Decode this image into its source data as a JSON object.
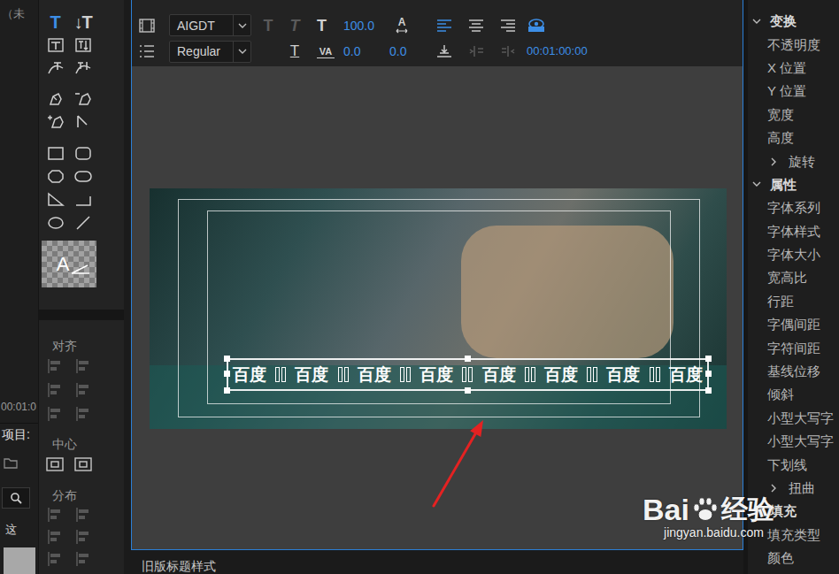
{
  "left_strip": {
    "title": "（未",
    "timecode": "00:01:0",
    "tab": "项目:",
    "item": "这"
  },
  "tools": [
    {
      "kind": "type",
      "glyph": "T",
      "selected": true
    },
    {
      "kind": "vertical-type",
      "glyph": "↓T",
      "selected": false
    },
    {
      "kind": "area-type",
      "selected": false
    },
    {
      "kind": "vertical-area-type",
      "selected": false
    },
    {
      "kind": "path-type",
      "selected": false
    },
    {
      "kind": "vertical-path-type",
      "selected": false
    },
    {
      "kind": "pen",
      "selected": false
    },
    {
      "kind": "delete-anchor",
      "selected": false
    },
    {
      "kind": "add-anchor",
      "selected": false
    },
    {
      "kind": "convert-anchor",
      "selected": false
    },
    {
      "kind": "rectangle",
      "selected": false
    },
    {
      "kind": "rounded-rectangle",
      "selected": false
    },
    {
      "kind": "clipped-rectangle",
      "selected": false
    },
    {
      "kind": "pill",
      "selected": false
    },
    {
      "kind": "wedge",
      "selected": false
    },
    {
      "kind": "arc",
      "selected": false
    },
    {
      "kind": "ellipse",
      "selected": false
    },
    {
      "kind": "line",
      "selected": false
    }
  ],
  "style_preview": {
    "glyph": "A"
  },
  "align_groups": [
    {
      "label": "对齐",
      "disabled": true
    },
    {
      "label": "中心",
      "disabled": false
    },
    {
      "label": "分布",
      "disabled": true
    }
  ],
  "toolbar": {
    "font_family": "AIGDT",
    "font_style": "Regular",
    "style_buttons": [
      {
        "kind": "bold",
        "glyph": "T",
        "disabled": true
      },
      {
        "kind": "italic",
        "glyph": "T",
        "disabled": true
      }
    ],
    "underline": {
      "glyph": "T",
      "disabled": false
    },
    "size_glyph": "T",
    "font_size": "100.0",
    "leading_glyph": "A",
    "leading": "0.0",
    "kerning_glyph": "VA",
    "kerning": "0.0",
    "paragraph_align": [
      {
        "kind": "left",
        "selected": true
      },
      {
        "kind": "center",
        "selected": false
      },
      {
        "kind": "right",
        "selected": false
      }
    ],
    "paragraph_tools": [
      {
        "disabled": false
      },
      {
        "disabled": true
      },
      {
        "disabled": true
      }
    ],
    "timecode": "00:01:00:00"
  },
  "title": {
    "selected": true,
    "segments": [
      "百度",
      "百度",
      "百度",
      "百度",
      "百度",
      "百度",
      "百度",
      "百度"
    ]
  },
  "right_panel": {
    "sections": [
      {
        "label": "变换",
        "expanded": true,
        "items": [
          {
            "label": "不透明度",
            "kind": "property"
          },
          {
            "label": "X 位置",
            "kind": "property"
          },
          {
            "label": "Y 位置",
            "kind": "property"
          },
          {
            "label": "宽度",
            "kind": "property"
          },
          {
            "label": "高度",
            "kind": "property"
          },
          {
            "label": "旋转",
            "kind": "group",
            "expanded": false
          }
        ]
      },
      {
        "label": "属性",
        "expanded": true,
        "items": [
          {
            "label": "字体系列",
            "kind": "property"
          },
          {
            "label": "字体样式",
            "kind": "property"
          },
          {
            "label": "字体大小",
            "kind": "property"
          },
          {
            "label": "宽高比",
            "kind": "property"
          },
          {
            "label": "行距",
            "kind": "property"
          },
          {
            "label": "字偶间距",
            "kind": "property"
          },
          {
            "label": "字符间距",
            "kind": "property"
          },
          {
            "label": "基线位移",
            "kind": "property"
          },
          {
            "label": "倾斜",
            "kind": "property"
          },
          {
            "label": "小型大写字",
            "kind": "property"
          },
          {
            "label": "小型大写字",
            "kind": "property"
          },
          {
            "label": "下划线",
            "kind": "property"
          },
          {
            "label": "扭曲",
            "kind": "group",
            "expanded": false
          }
        ]
      },
      {
        "label": "填充",
        "expanded": true,
        "items": [
          {
            "label": "填充类型",
            "kind": "property"
          },
          {
            "label": "颜色",
            "kind": "property"
          }
        ]
      }
    ]
  },
  "bottom_tab": "旧版标题样式",
  "watermark": {
    "brand": "Bai",
    "suffix": "经验",
    "url": "jingyan.baidu.com"
  }
}
